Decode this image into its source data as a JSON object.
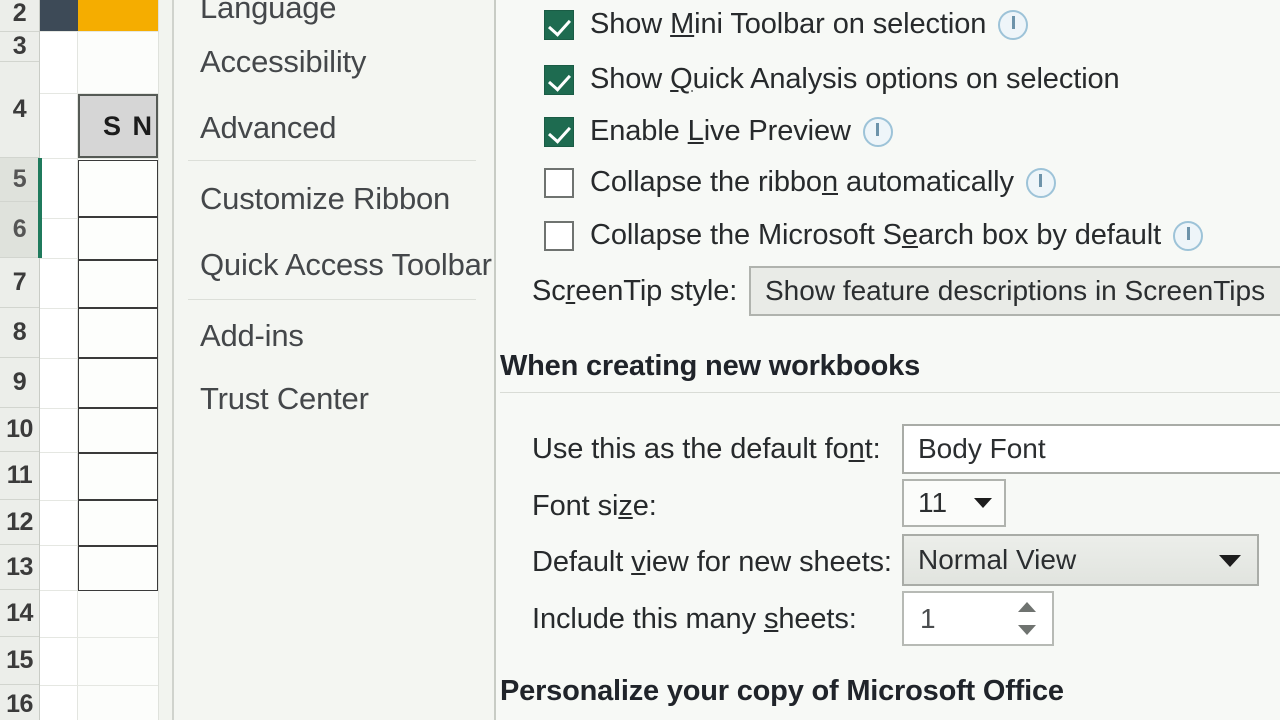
{
  "spreadsheet": {
    "row_headers": [
      "2",
      "3",
      "4",
      "5",
      "6",
      "7",
      "8",
      "9",
      "10",
      "11",
      "12",
      "13",
      "14",
      "15",
      "16"
    ],
    "selected_rows": [
      "5",
      "6"
    ],
    "header_cell_text": "S N",
    "accent_navy": "#3d4a57",
    "accent_orange": "#f5ad00",
    "selection_green": "#1f7a5c"
  },
  "dialog": {
    "nav": {
      "items": [
        {
          "label": "Language",
          "separator_after": false
        },
        {
          "label": "Accessibility",
          "separator_after": false
        },
        {
          "label": "Advanced",
          "separator_after": true
        },
        {
          "label": "Customize Ribbon",
          "separator_after": false
        },
        {
          "label": "Quick Access Toolbar",
          "separator_after": true
        },
        {
          "label": "Add-ins",
          "separator_after": false
        },
        {
          "label": "Trust Center",
          "separator_after": false
        }
      ]
    },
    "user_interface_options": {
      "checkboxes": [
        {
          "label_pre": "Show ",
          "accel": "M",
          "label_post": "ini Toolbar on selection",
          "checked": true,
          "info": true
        },
        {
          "label_pre": "Show ",
          "accel": "Q",
          "label_post": "uick Analysis options on selection",
          "checked": true,
          "info": false
        },
        {
          "label_pre": "Enable ",
          "accel": "L",
          "label_post": "ive Preview",
          "checked": true,
          "info": true
        },
        {
          "label_pre": "Collapse the ribbo",
          "accel": "n",
          "label_post": " automatically",
          "checked": false,
          "info": true
        },
        {
          "label_pre": "Collapse the Microsoft S",
          "accel": "e",
          "label_post": "arch box by default",
          "checked": false,
          "info": true
        }
      ],
      "screentip": {
        "label_pre": "Sc",
        "accel": "r",
        "label_post": "eenTip style:",
        "value": "Show feature descriptions in ScreenTips"
      }
    },
    "new_workbooks": {
      "heading": "When creating new workbooks",
      "default_font": {
        "label_pre": "Use this as the default fo",
        "accel": "n",
        "label_post": "t:",
        "value": "Body Font"
      },
      "font_size": {
        "label_pre": "Font si",
        "accel": "z",
        "label_post": "e:",
        "value": "11"
      },
      "default_view": {
        "label_pre": "Default ",
        "accel": "v",
        "label_post": "iew for new sheets:",
        "value": "Normal View"
      },
      "sheet_count": {
        "label_pre": "Include this many ",
        "accel": "s",
        "label_post": "heets:",
        "value": "1"
      }
    },
    "personalize": {
      "heading": "Personalize your copy of Microsoft Office"
    }
  }
}
